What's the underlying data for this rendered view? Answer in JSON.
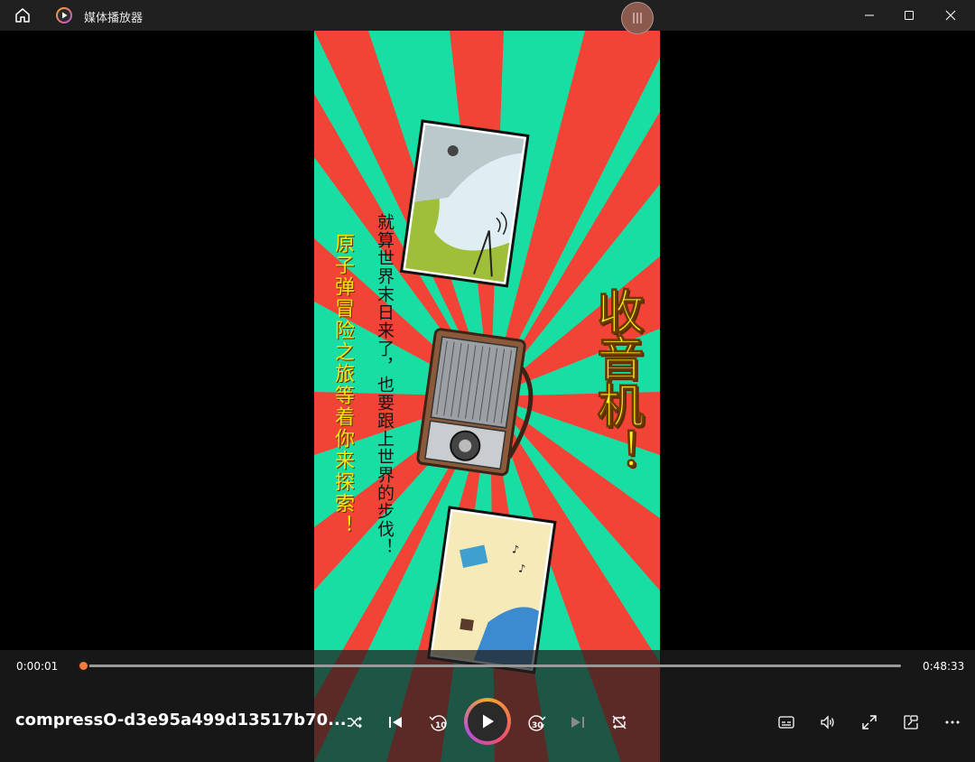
{
  "app": {
    "title": "媒体播放器"
  },
  "titlebar": {
    "home_icon": "home-icon",
    "app_icon": "media-player-icon",
    "minimize_icon": "minimize-icon",
    "maximize_icon": "maximize-icon",
    "close_icon": "close-icon"
  },
  "video": {
    "headline": "收音机！",
    "subtext": "就算世界末日来了，也要跟上世界的步伐！",
    "tagline": "原子弹冒险之旅等着你来探索！",
    "colors": {
      "red": "#f24436",
      "teal": "#19dea4",
      "headline": "#fff21a"
    }
  },
  "player": {
    "current_time": "0:00:01",
    "duration": "0:48:33",
    "progress": 0.0003,
    "media_title": "compressO-d3e95a499d13517b70...",
    "skip_back_seconds": "10",
    "skip_forward_seconds": "30",
    "state": "paused"
  },
  "controls": {
    "shuffle": "shuffle-icon",
    "previous": "previous-icon",
    "skip_back": "skip-back-10-icon",
    "play": "play-icon",
    "skip_forward": "skip-forward-30-icon",
    "next": "next-icon",
    "repeat": "repeat-icon",
    "captions": "captions-icon",
    "volume": "volume-icon",
    "fullscreen": "fullscreen-icon",
    "mini_player": "mini-player-icon",
    "more": "more-options-icon"
  }
}
